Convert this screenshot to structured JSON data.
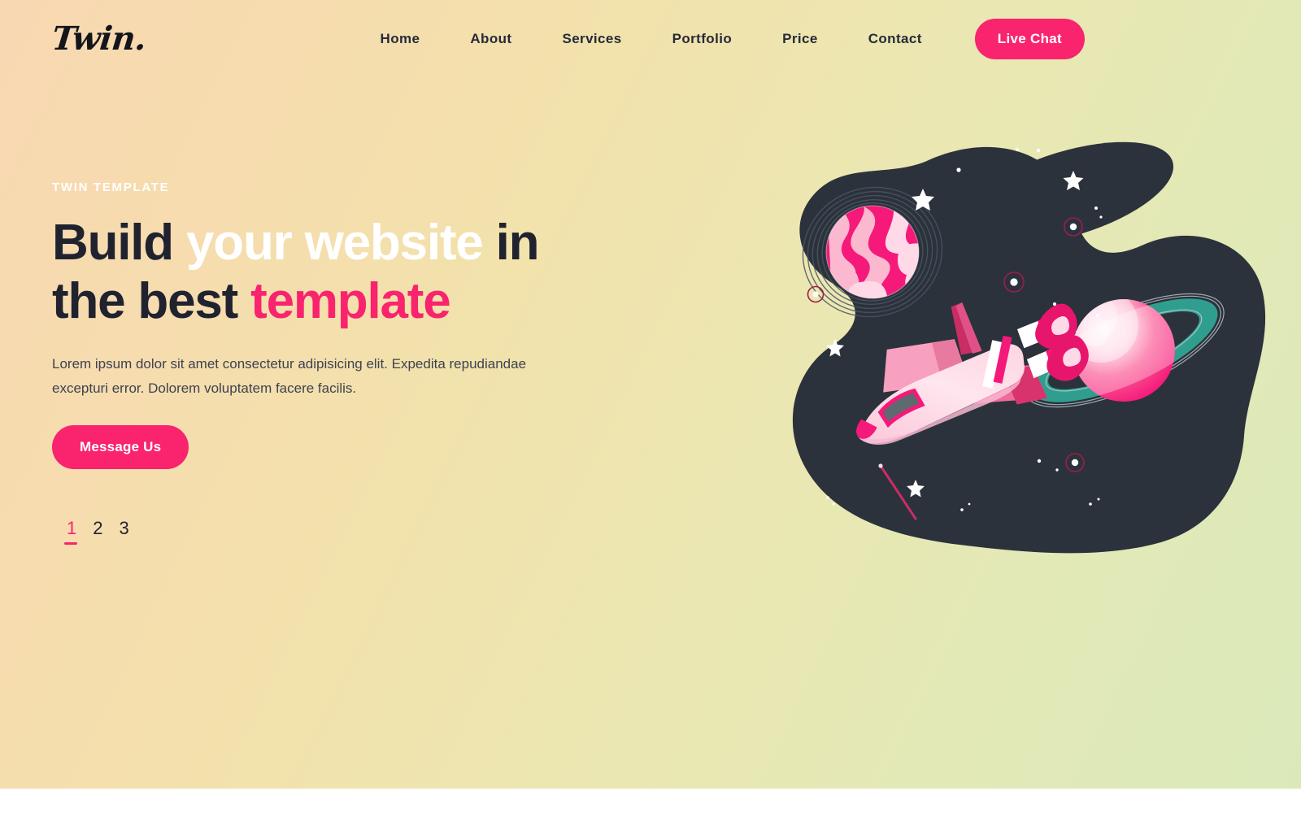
{
  "brand": {
    "logo": "Twin."
  },
  "nav": {
    "links": [
      {
        "label": "Home"
      },
      {
        "label": "About"
      },
      {
        "label": "Services"
      },
      {
        "label": "Portfolio"
      },
      {
        "label": "Price"
      },
      {
        "label": "Contact"
      }
    ],
    "cta": {
      "label": "Live Chat",
      "color": "#f9236e"
    }
  },
  "hero": {
    "eyebrow": "TWIN TEMPLATE",
    "headline": {
      "part1": "Build ",
      "part2": "your website",
      "part3": " in",
      "part4": "the best ",
      "part5": "template"
    },
    "paragraph": "Lorem ipsum dolor sit amet consectetur adipisicing elit. Expedita repudiandae excepturi error. Dolorem voluptatem facere facilis.",
    "cta": {
      "label": "Message Us"
    },
    "pagination": {
      "items": [
        "1",
        "2",
        "3"
      ],
      "active": "1"
    }
  },
  "illustration": {
    "name": "space-scene",
    "elements": [
      "dark-blob",
      "small-blob",
      "marbled-planet",
      "ringed-planet",
      "space-shuttle",
      "stars",
      "comet-streak"
    ]
  },
  "colors": {
    "accent_pink": "#f9236e",
    "heading_dark": "#20232f",
    "space_dark": "#2b323b",
    "ring_teal": "#2f9e8f",
    "bg_start": "#f8d8b2",
    "bg_end": "#dbe9ba"
  }
}
